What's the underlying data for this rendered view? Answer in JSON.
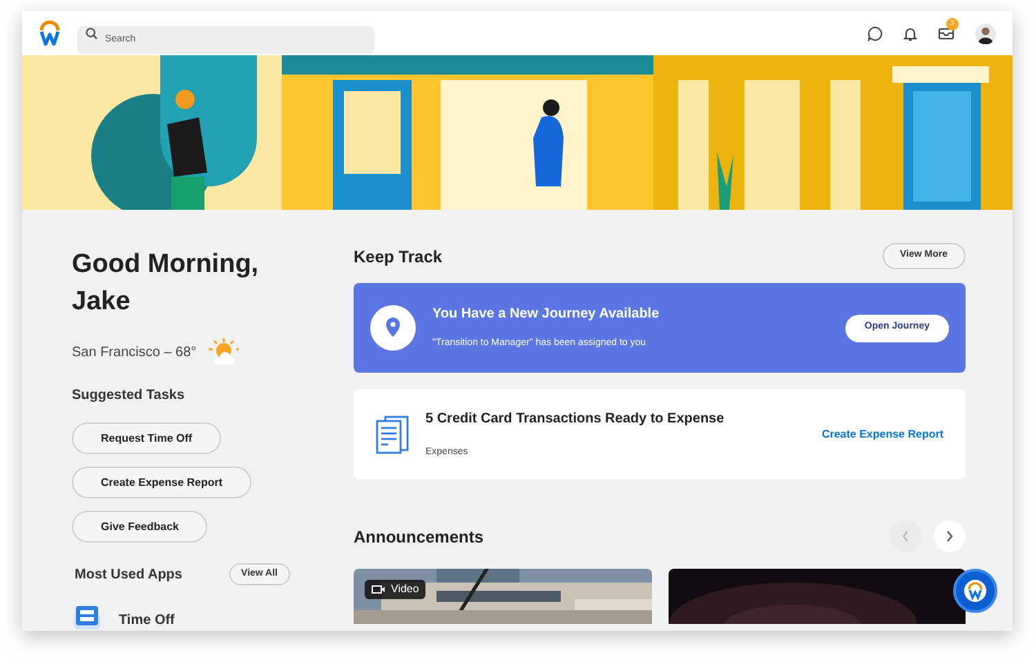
{
  "header": {
    "search": {
      "placeholder": "Search"
    },
    "inbox_badge": "3"
  },
  "greeting": {
    "title": "Good Morning, Jake",
    "weather": "San Francisco – 68°"
  },
  "suggested_tasks": {
    "title": "Suggested Tasks",
    "buttons": [
      "Request Time Off",
      "Create Expense Report",
      "Give Feedback"
    ]
  },
  "most_used_apps": {
    "title": "Most Used Apps",
    "view_all": "View All",
    "apps": [
      "Time Off"
    ]
  },
  "keep_track": {
    "title": "Keep Track",
    "view_more": "View More",
    "cards": [
      {
        "kind": "journey",
        "title": "You Have a New Journey Available",
        "subtitle": "\"Transition to Manager\" has been assigned to you",
        "action": "Open Journey"
      },
      {
        "kind": "expense",
        "title": "5 Credit Card Transactions Ready to Expense",
        "subtitle": "Expenses",
        "action": "Create Expense Report"
      }
    ]
  },
  "announcements": {
    "title": "Announcements",
    "prev_disabled": true,
    "items": [
      {
        "kind": "picture",
        "badge": "Video"
      },
      {
        "kind": "picture"
      }
    ]
  }
}
